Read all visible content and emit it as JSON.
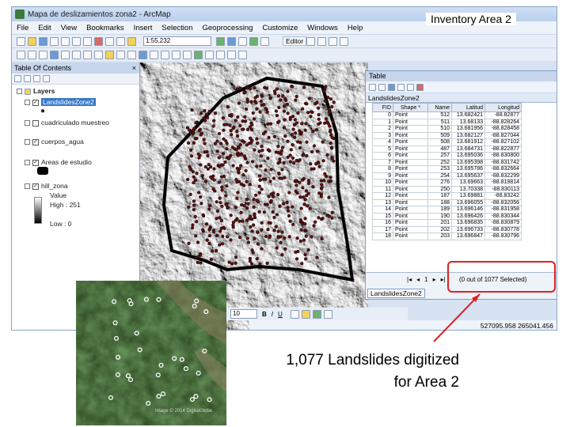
{
  "window": {
    "title": "Mapa de deslizamientos zona2 - ArcMap",
    "menu": [
      "File",
      "Edit",
      "View",
      "Bookmarks",
      "Insert",
      "Selection",
      "Geoprocessing",
      "Customize",
      "Windows",
      "Help"
    ],
    "scale": "1:55,232",
    "editor": "Editor"
  },
  "toc": {
    "title": "Table Of Contents",
    "root": "Layers",
    "layers": [
      {
        "label": "LandslidesZone2",
        "checked": true,
        "selected": true
      },
      {
        "label": "cuadriculado muestreo",
        "checked": false
      },
      {
        "label": "cuerpos_agua",
        "checked": true
      },
      {
        "label": "Areas de estudio",
        "checked": true
      },
      {
        "label": "hill_zona",
        "checked": true
      }
    ],
    "legend": {
      "value": "Value",
      "high": "High : 251",
      "low": "Low : 0"
    }
  },
  "attribute_table": {
    "window_title": "Table",
    "layer_name": "LandslidesZone2",
    "columns": [
      "FID",
      "Shape *",
      "Name",
      "Latitud",
      "Longitud"
    ],
    "rows": [
      [
        "0",
        "Point",
        "512",
        "13.682421",
        "-88.82877"
      ],
      [
        "1",
        "Point",
        "511",
        "13.68133",
        "-88.828264"
      ],
      [
        "2",
        "Point",
        "510",
        "13.681956",
        "-88.828458"
      ],
      [
        "3",
        "Point",
        "509",
        "13.682127",
        "-88.827044"
      ],
      [
        "4",
        "Point",
        "508",
        "13.681912",
        "-88.827102"
      ],
      [
        "5",
        "Point",
        "487",
        "13.684731",
        "-88.822877"
      ],
      [
        "6",
        "Point",
        "257",
        "13.695036",
        "-88.830800"
      ],
      [
        "7",
        "Point",
        "252",
        "13.695398",
        "-88.831742"
      ],
      [
        "8",
        "Point",
        "253",
        "13.695786",
        "-88.832664"
      ],
      [
        "9",
        "Point",
        "254",
        "13.695637",
        "-88.832299"
      ],
      [
        "10",
        "Point",
        "276",
        "13.69663",
        "-88.819814"
      ],
      [
        "11",
        "Point",
        "250",
        "13.70338",
        "-88.830113"
      ],
      [
        "12",
        "Point",
        "187",
        "13.69881",
        "-88.83242"
      ],
      [
        "13",
        "Point",
        "188",
        "13.696055",
        "-88.832056"
      ],
      [
        "14",
        "Point",
        "189",
        "13.696146",
        "-88.831958"
      ],
      [
        "15",
        "Point",
        "190",
        "13.696426",
        "-88.830344"
      ],
      [
        "16",
        "Point",
        "201",
        "13.696835",
        "-88.830879"
      ],
      [
        "17",
        "Point",
        "202",
        "13.696733",
        "-88.830778"
      ],
      [
        "18",
        "Point",
        "203",
        "13.696847",
        "-88.830796"
      ]
    ],
    "record": "1",
    "selection_status": "(0 out of 1077 Selected)",
    "tab_label": "LandslidesZone2"
  },
  "statusbar": {
    "coords": "527095.958  265041.456",
    "font_size": "10"
  },
  "slide": {
    "heading": "Inventory Area  2",
    "caption_line1": "1,077 Landslides digitized",
    "caption_line2": "for Area 2",
    "satellite_credit": "Image © 2014 DigitalGlobe"
  },
  "colors": {
    "highlight": "#e02020",
    "selected_layer": "#3a78c9",
    "landslide_point": "#5a1212"
  }
}
